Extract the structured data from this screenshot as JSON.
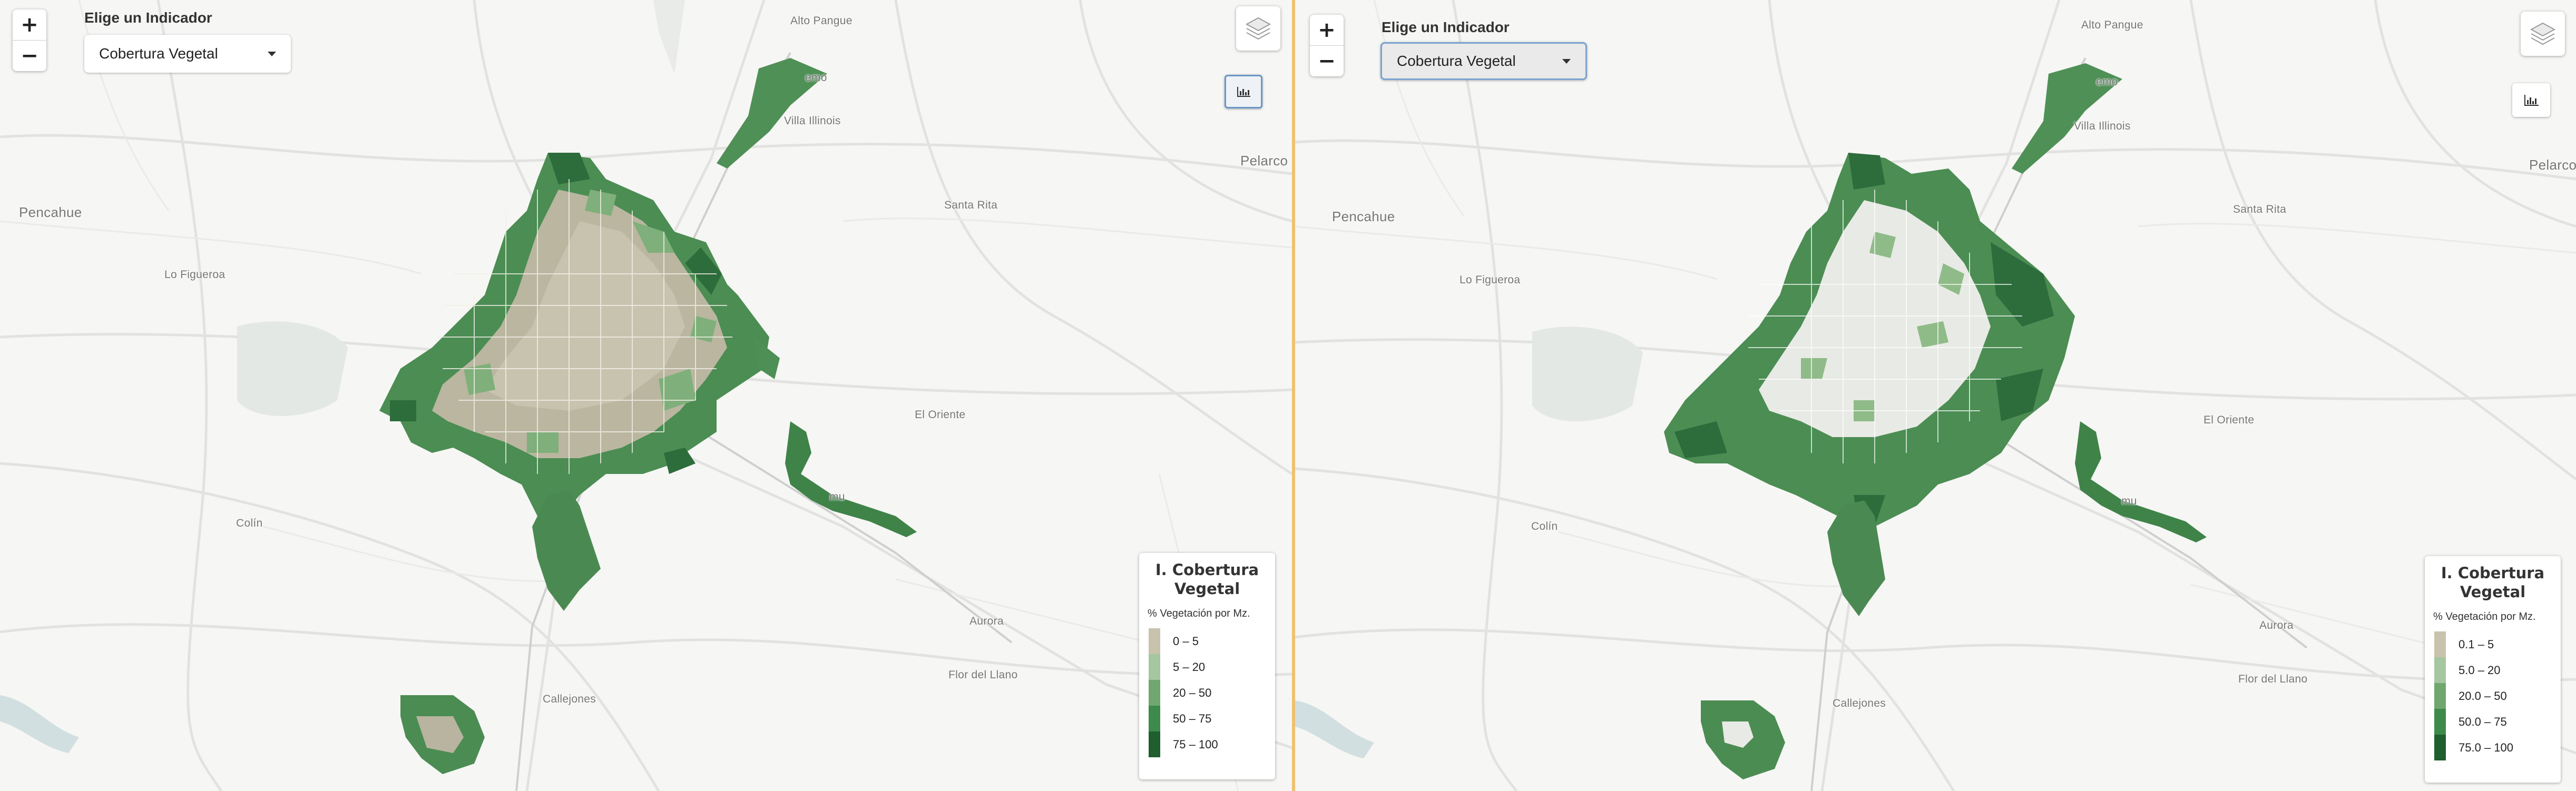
{
  "indicator_label": "Elige un Indicador",
  "panels": [
    {
      "id": "left",
      "selected_indicator": "Cobertura Vegetal",
      "zoom_in": "+",
      "zoom_out": "−",
      "place_names": {
        "alto_pangue": "Alto Pangue",
        "talca_remo": "emo",
        "villa_illinois": "Villa Illinois",
        "pelarco": "Pelarco",
        "pencahue": "Pencahue",
        "santa_rita": "Santa Rita",
        "lo_figueroa": "Lo Figueroa",
        "el_oriente": "El Oriente",
        "colin": "Colín",
        "aurora": "Aurora",
        "flor_del_llano": "Flor del Llano",
        "callejones": "Callejones",
        "huilquilemu": "mu"
      },
      "legend": {
        "title": "I. Cobertura Vegetal",
        "subtitle": "% Vegetación por Mz.",
        "items": [
          {
            "label": "0 – 5",
            "color": "#c9c2ad"
          },
          {
            "label": "5 – 20",
            "color": "#a5c6a0"
          },
          {
            "label": "20 – 50",
            "color": "#6fa76f"
          },
          {
            "label": "50 – 75",
            "color": "#3d8a4b"
          },
          {
            "label": "75 – 100",
            "color": "#1e5e2f"
          }
        ]
      }
    },
    {
      "id": "right",
      "selected_indicator": "Cobertura Vegetal",
      "zoom_in": "+",
      "zoom_out": "−",
      "place_names": {
        "alto_pangue": "Alto Pangue",
        "talca_remo": "emo",
        "villa_illinois": "Villa Illinois",
        "pelarco": "Pelarco",
        "pencahue": "Pencahue",
        "santa_rita": "Santa Rita",
        "lo_figueroa": "Lo Figueroa",
        "el_oriente": "El Oriente",
        "colin": "Colín",
        "aurora": "Aurora",
        "flor_del_llano": "Flor del Llano",
        "callejones": "Callejones",
        "huilquilemu": "mu"
      },
      "legend": {
        "title": "I. Cobertura Vegetal",
        "subtitle": "% Vegetación por Mz.",
        "items": [
          {
            "label": "0.1 – 5",
            "color": "#c9c2ad"
          },
          {
            "label": "5.0 – 20",
            "color": "#a5c6a0"
          },
          {
            "label": "20.0 – 50",
            "color": "#6fa76f"
          },
          {
            "label": "50.0 – 75",
            "color": "#3d8a4b"
          },
          {
            "label": "75.0 – 100",
            "color": "#1e5e2f"
          }
        ]
      }
    }
  ],
  "colors": {
    "urban_fill_left": "#b9b59f",
    "urban_fill_right": "#e9ebe6",
    "vegetation": "#4e8f55",
    "vegetation_dark": "#2f6f3d",
    "road": "#dcdcdc",
    "water": "#c9d9dc"
  },
  "icons": {
    "layers": "layers-icon",
    "chart": "bar-chart-icon",
    "dropdown": "caret-down-icon"
  }
}
